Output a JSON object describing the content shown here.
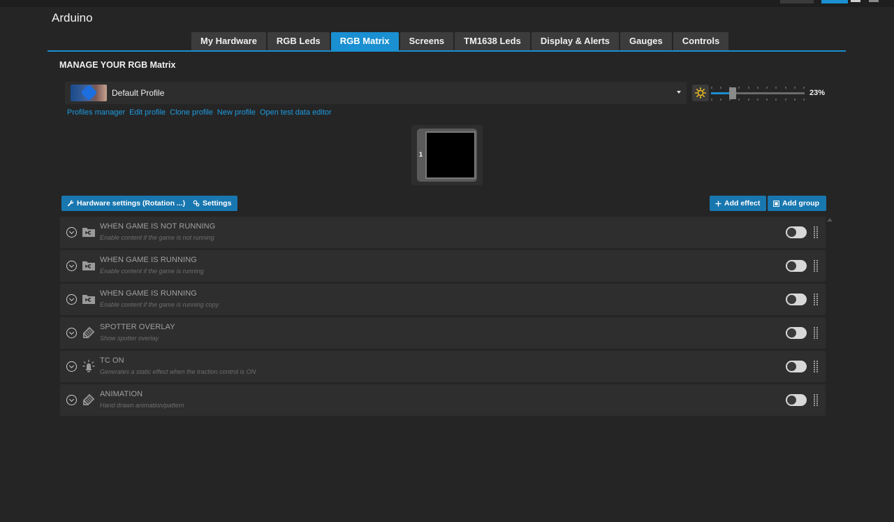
{
  "app": {
    "title": "Arduino"
  },
  "colors": {
    "accent": "#1a8fd1",
    "link": "#1e9be0",
    "button": "#1977b0"
  },
  "tabs": [
    {
      "label": "My Hardware",
      "active": false
    },
    {
      "label": "RGB Leds",
      "active": false
    },
    {
      "label": "RGB Matrix",
      "active": true
    },
    {
      "label": "Screens",
      "active": false
    },
    {
      "label": "TM1638 Leds",
      "active": false
    },
    {
      "label": "Display & Alerts",
      "active": false
    },
    {
      "label": "Gauges",
      "active": false
    },
    {
      "label": "Controls",
      "active": false
    }
  ],
  "section": {
    "title": "MANAGE YOUR RGB Matrix"
  },
  "profile": {
    "name": "Default Profile",
    "icon": "gamepad-icon"
  },
  "brightness": {
    "value": 23,
    "label": "23%",
    "icon": "sun-icon"
  },
  "links": [
    "Profiles manager",
    "Edit profile",
    "Clone profile",
    "New profile",
    "Open test data editor"
  ],
  "matrix": {
    "number": "1"
  },
  "buttons": {
    "hardware_settings": "Hardware settings (Rotation ...)",
    "settings": "Settings",
    "add_effect": "Add effect",
    "add_group": "Add group"
  },
  "effects": [
    {
      "title": "WHEN GAME IS NOT RUNNING",
      "subtitle": "Enable content if the game is not running",
      "icon": "folder-flow-icon",
      "enabled": false
    },
    {
      "title": "WHEN GAME IS RUNNING",
      "subtitle": "Enable content if the game is running",
      "icon": "folder-flow-icon",
      "enabled": false
    },
    {
      "title": "WHEN GAME IS RUNNING",
      "subtitle": "Enable content if the game is running copy",
      "icon": "folder-flow-icon",
      "enabled": false
    },
    {
      "title": "SPOTTER OVERLAY",
      "subtitle": "Show spotter overlay",
      "icon": "pencil-icon",
      "enabled": false
    },
    {
      "title": "TC ON",
      "subtitle": "Generates a static effect when the traction control is ON",
      "icon": "light-bulb-icon",
      "enabled": false
    },
    {
      "title": "ANIMATION",
      "subtitle": "Hand drawn animation/pattern",
      "icon": "pencil-icon",
      "enabled": false
    }
  ]
}
